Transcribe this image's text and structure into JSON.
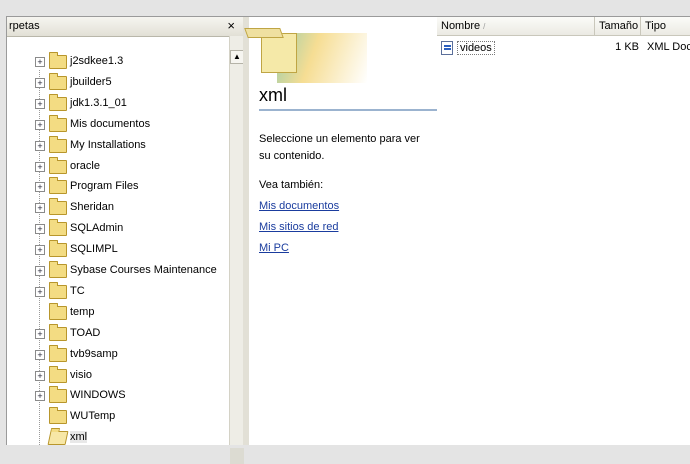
{
  "folders_pane": {
    "title": "rpetas",
    "close": "×",
    "items": [
      {
        "label": "j2sdkee1.3",
        "expandable": true
      },
      {
        "label": "jbuilder5",
        "expandable": true
      },
      {
        "label": "jdk1.3.1_01",
        "expandable": true
      },
      {
        "label": "Mis documentos",
        "expandable": true
      },
      {
        "label": "My Installations",
        "expandable": true
      },
      {
        "label": "oracle",
        "expandable": true
      },
      {
        "label": "Program Files",
        "expandable": true
      },
      {
        "label": "Sheridan",
        "expandable": true
      },
      {
        "label": "SQLAdmin",
        "expandable": true
      },
      {
        "label": "SQLIMPL",
        "expandable": true
      },
      {
        "label": "Sybase Courses Maintenance",
        "expandable": true
      },
      {
        "label": "TC",
        "expandable": true
      },
      {
        "label": "temp",
        "expandable": false
      },
      {
        "label": "TOAD",
        "expandable": true
      },
      {
        "label": "tvb9samp",
        "expandable": true
      },
      {
        "label": "visio",
        "expandable": true
      },
      {
        "label": "WINDOWS",
        "expandable": true
      },
      {
        "label": "WUTemp",
        "expandable": false
      },
      {
        "label": "xml",
        "expandable": false,
        "selected": true
      }
    ]
  },
  "webview": {
    "title": "xml",
    "description": "Seleccione un elemento para ver su contenido.",
    "see_also": "Vea también:",
    "links": [
      "Mis documentos",
      "Mis sitios de red",
      "Mi PC"
    ]
  },
  "list": {
    "columns": {
      "name": "Nombre",
      "size": "Tamaño",
      "type": "Tipo"
    },
    "rows": [
      {
        "name": "videos",
        "size": "1 KB",
        "type": "XML Docu"
      }
    ]
  },
  "colors": {
    "link": "#1a3c9e",
    "folder": "#f3dc83"
  }
}
